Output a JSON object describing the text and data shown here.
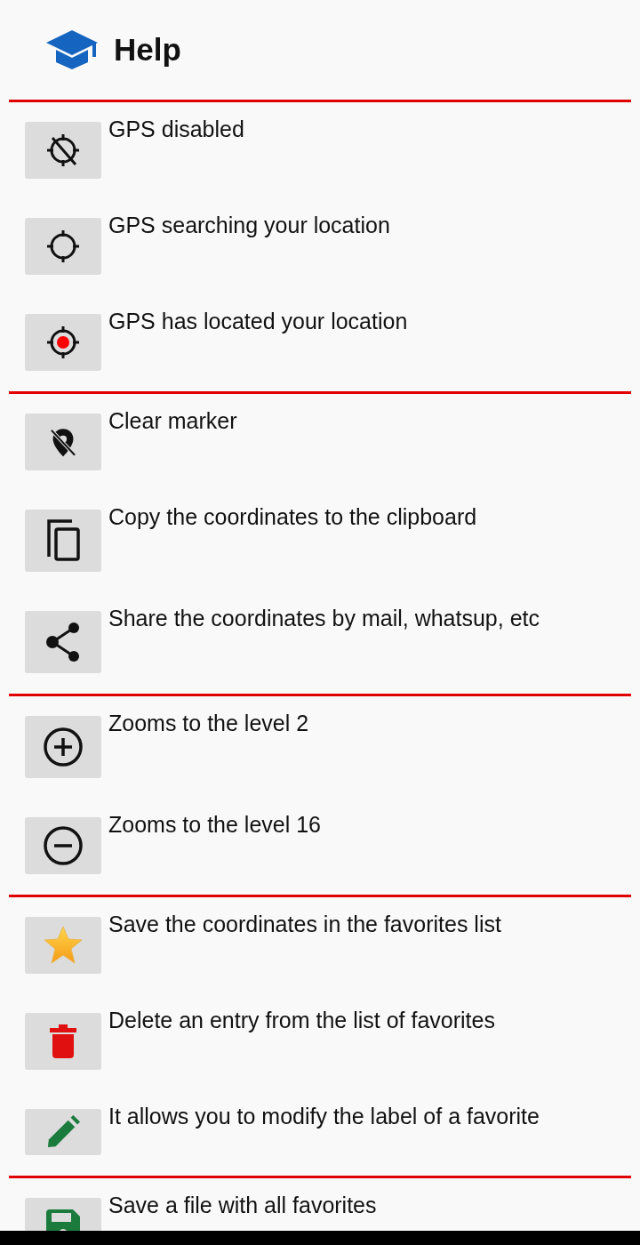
{
  "header": {
    "title": "Help"
  },
  "sections": [
    {
      "items": [
        {
          "kind": "gps-off",
          "text": "GPS disabled"
        },
        {
          "kind": "gps-searching",
          "text": "GPS searching your location"
        },
        {
          "kind": "gps-fixed",
          "text": "GPS has located your location"
        }
      ]
    },
    {
      "items": [
        {
          "kind": "marker-off",
          "text": "Clear marker"
        },
        {
          "kind": "copy",
          "text": "Copy the coordinates to the clipboard"
        },
        {
          "kind": "share",
          "text": "Share the coordinates by mail, whatsup, etc"
        }
      ]
    },
    {
      "items": [
        {
          "kind": "zoom-in",
          "text": "Zooms to the level 2"
        },
        {
          "kind": "zoom-out",
          "text": "Zooms to the level 16"
        }
      ]
    },
    {
      "items": [
        {
          "kind": "star",
          "text": "Save the coordinates in the favorites list"
        },
        {
          "kind": "delete",
          "text": "Delete an entry from the list of favorites"
        },
        {
          "kind": "edit",
          "text": "It allows you to modify the label of a favorite"
        }
      ]
    },
    {
      "items": [
        {
          "kind": "save",
          "text": "Save a file with all favorites"
        }
      ]
    }
  ]
}
